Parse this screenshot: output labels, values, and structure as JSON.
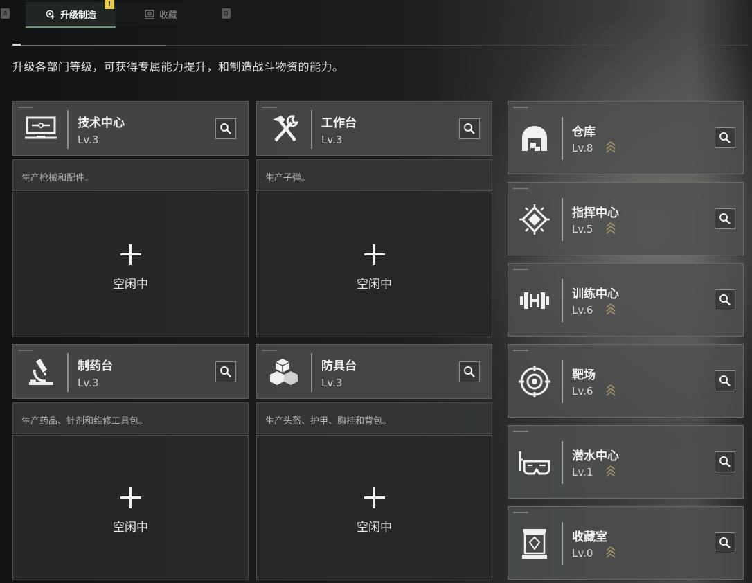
{
  "tabs": {
    "key_left": "A",
    "key_right": "D",
    "alert_mark": "!",
    "items": [
      {
        "label": "升级制造",
        "active": true
      },
      {
        "label": "收藏",
        "active": false
      }
    ]
  },
  "description": "升级各部门等级，可获得专属能力提升，和制造战斗物资的能力。",
  "production": [
    {
      "title": "技术中心",
      "level": "Lv.3",
      "desc": "生产枪械和配件。",
      "status": "空闲中",
      "icon": "computer-icon"
    },
    {
      "title": "工作台",
      "level": "Lv.3",
      "desc": "生产子弹。",
      "status": "空闲中",
      "icon": "hammer-wrench-icon"
    },
    {
      "title": "制药台",
      "level": "Lv.3",
      "desc": "生产药品、针剂和维修工具包。",
      "status": "空闲中",
      "icon": "microscope-icon"
    },
    {
      "title": "防具台",
      "level": "Lv.3",
      "desc": "生产头盔、护甲、胸挂和背包。",
      "status": "空闲中",
      "icon": "cubes-icon"
    }
  ],
  "facilities": [
    {
      "title": "仓库",
      "level": "Lv.8",
      "icon": "warehouse-icon"
    },
    {
      "title": "指挥中心",
      "level": "Lv.5",
      "icon": "command-chip-icon"
    },
    {
      "title": "训练中心",
      "level": "Lv.6",
      "icon": "dumbbell-icon"
    },
    {
      "title": "靶场",
      "level": "Lv.6",
      "icon": "target-icon"
    },
    {
      "title": "潜水中心",
      "level": "Lv.1",
      "icon": "diving-mask-icon"
    },
    {
      "title": "收藏室",
      "level": "Lv.0",
      "icon": "display-case-icon"
    }
  ],
  "colors": {
    "accent": "#6a9a7a",
    "alert": "#e8c84a",
    "upgrade_chevron": "#a8956a"
  }
}
